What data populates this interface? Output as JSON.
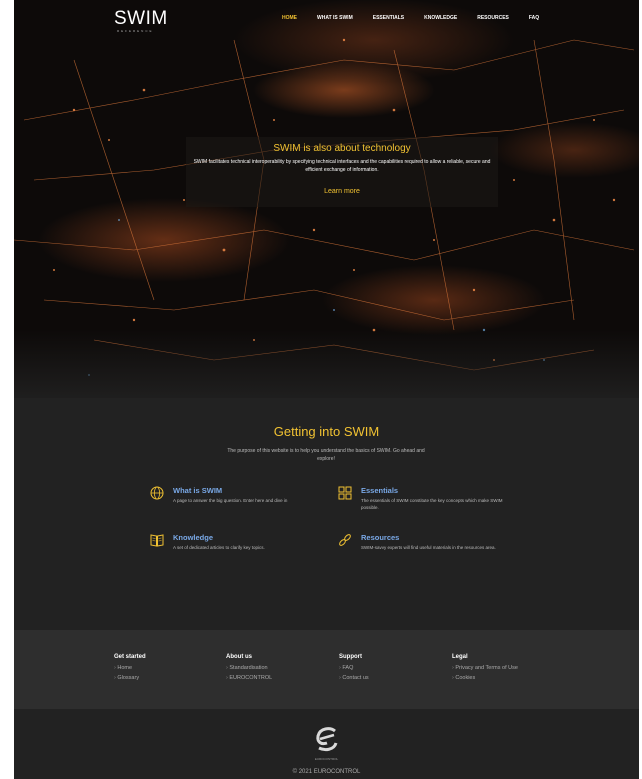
{
  "header": {
    "logo": "SWIM",
    "logo_sub": "REFERENCE",
    "nav": [
      {
        "label": "HOME",
        "active": true
      },
      {
        "label": "WHAT IS SWIM",
        "active": false
      },
      {
        "label": "ESSENTIALS",
        "active": false
      },
      {
        "label": "KNOWLEDGE",
        "active": false
      },
      {
        "label": "RESOURCES",
        "active": false
      },
      {
        "label": "FAQ",
        "active": false
      }
    ]
  },
  "hero": {
    "title": "SWIM is also about technology",
    "text": "SWIM facilitates technical interoperability by specifying technical interfaces and the capabilities required to allow a reliable, secure and efficient exchange of information.",
    "cta": "Learn more"
  },
  "intro": {
    "title": "Getting into SWIM",
    "subtitle": "The purpose of this website is to help you understand the basics of SWIM. Go ahead and explore!"
  },
  "features": [
    {
      "icon": "globe-icon",
      "title": "What is SWIM",
      "description": "A page to answer the big question. Enter here and dive in"
    },
    {
      "icon": "grid-icon",
      "title": "Essentials",
      "description": "The essentials of SWIM constitute the key concepts which make SWIM possible."
    },
    {
      "icon": "book-icon",
      "title": "Knowledge",
      "description": "A set of dedicated articles to clarify key topics."
    },
    {
      "icon": "link-icon",
      "title": "Resources",
      "description": "SWIM-savvy experts will find useful materials in the resources area."
    }
  ],
  "footer": {
    "columns": [
      {
        "heading": "Get started",
        "links": [
          "Home",
          "Glossary"
        ]
      },
      {
        "heading": "About us",
        "links": [
          "Standardisation",
          "EUROCONTROL"
        ]
      },
      {
        "heading": "Support",
        "links": [
          "FAQ",
          "Contact us"
        ]
      },
      {
        "heading": "Legal",
        "links": [
          "Privacy and Terms of Use",
          "Cookies"
        ]
      }
    ],
    "logo_label": "EUROCONTROL",
    "copyright": "© 2021 EUROCONTROL"
  },
  "colors": {
    "accent": "#f1c232",
    "link": "#79a8e6",
    "background": "#222222"
  }
}
